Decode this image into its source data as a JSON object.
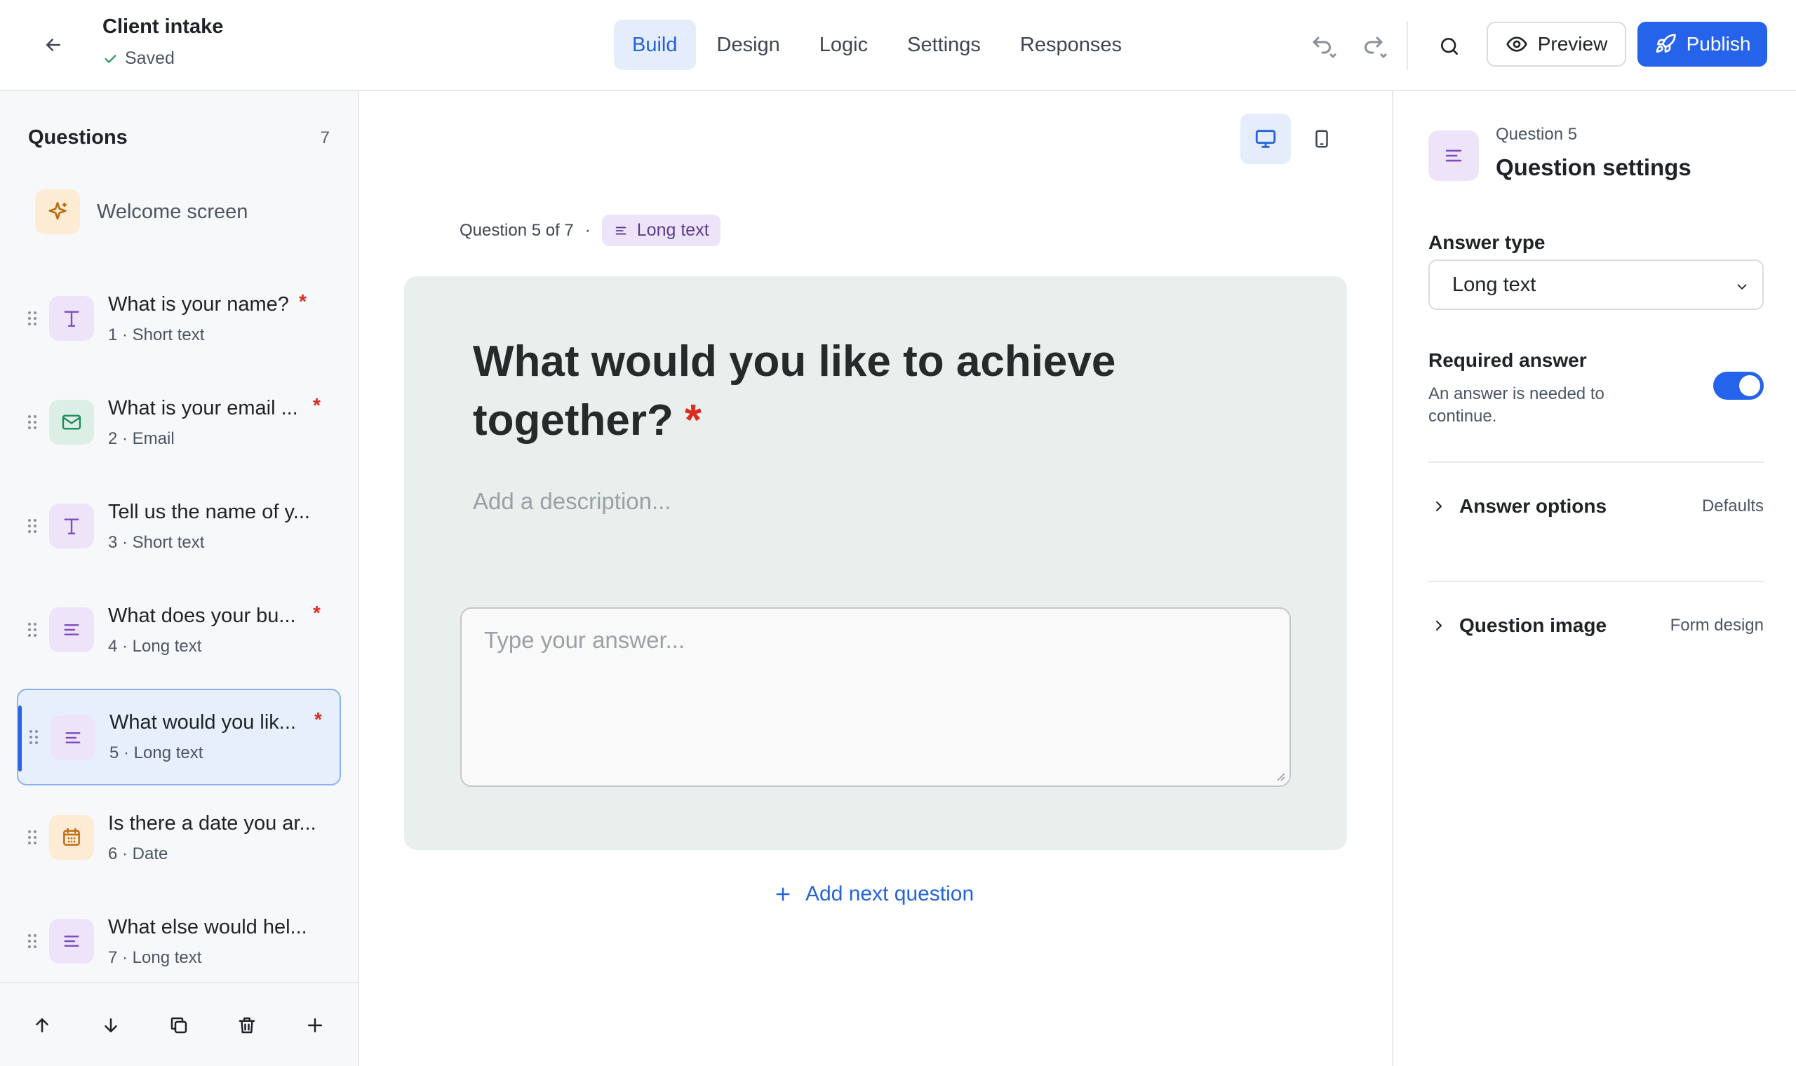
{
  "header": {
    "form_title": "Client intake",
    "saved_status": "Saved",
    "tabs": [
      "Build",
      "Design",
      "Logic",
      "Settings",
      "Responses"
    ],
    "active_tab": "Build",
    "preview_label": "Preview",
    "publish_label": "Publish"
  },
  "sidebar": {
    "title": "Questions",
    "count": "7",
    "welcome_label": "Welcome screen",
    "questions": [
      {
        "title": "What is your name?",
        "sub": "1 · Short text",
        "required": "*",
        "icon": "text-type-icon"
      },
      {
        "title": "What is your email ...",
        "sub": "2 · Email",
        "required": "*",
        "icon": "mail-icon"
      },
      {
        "title": "Tell us the name of y...",
        "sub": "3 · Short text",
        "required": "",
        "icon": "text-type-icon"
      },
      {
        "title": "What does your bu...",
        "sub": "4 · Long text",
        "required": "*",
        "icon": "long-text-icon"
      },
      {
        "title": "What would you lik...",
        "sub": "5 · Long text",
        "required": "*",
        "icon": "long-text-icon",
        "selected": true
      },
      {
        "title": "Is there a date you ar...",
        "sub": "6 · Date",
        "required": "",
        "icon": "calendar-icon"
      },
      {
        "title": "What else would hel...",
        "sub": "7 · Long text",
        "required": "",
        "icon": "long-text-icon"
      }
    ]
  },
  "canvas": {
    "question_position": "Question 5 of 7",
    "separator": "·",
    "type_chip": "Long text",
    "question_text": "What would you like to achieve together?",
    "required_mark": "*",
    "description_placeholder": "Add a description...",
    "answer_placeholder": "Type your answer...",
    "add_next_label": "Add next question",
    "active_device": "desktop"
  },
  "settings": {
    "subtitle": "Question 5",
    "title": "Question settings",
    "answer_type_label": "Answer type",
    "answer_type_value": "Long text",
    "required_title": "Required answer",
    "required_help": "An answer is needed to continue.",
    "required_on": true,
    "answer_options_label": "Answer options",
    "answer_options_value": "Defaults",
    "question_image_label": "Question image",
    "question_image_value": "Form design"
  },
  "colors": {
    "accent": "#2563eb",
    "required": "#d92d20",
    "card_bg": "#e9efec"
  }
}
